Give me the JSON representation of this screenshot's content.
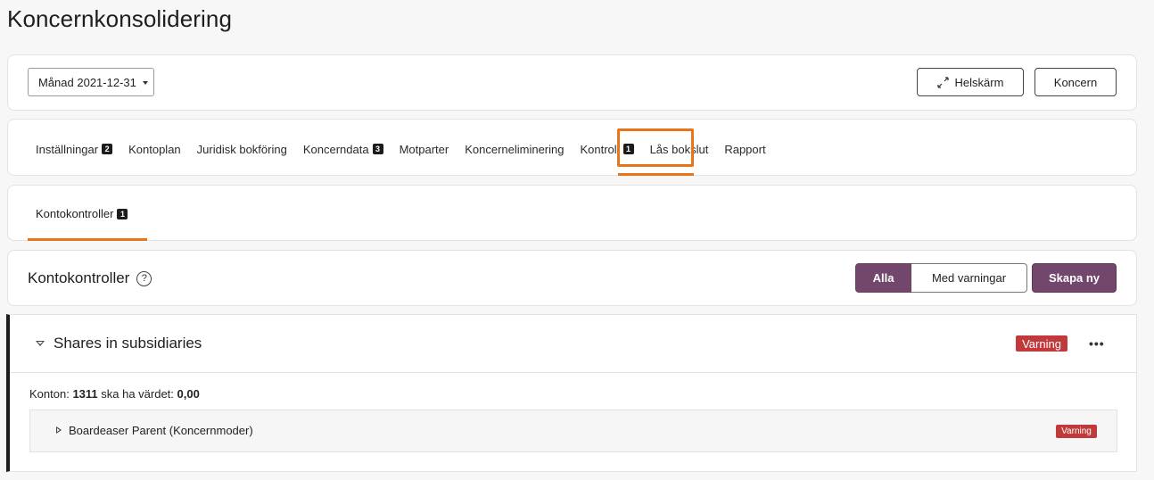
{
  "page": {
    "title": "Koncernkonsolidering"
  },
  "toolbar": {
    "period_value": "Månad 2021-12-31",
    "fullscreen_label": "Helskärm",
    "koncern_label": "Koncern"
  },
  "tabs": [
    {
      "label": "Inställningar",
      "badge": "2"
    },
    {
      "label": "Kontoplan",
      "badge": ""
    },
    {
      "label": "Juridisk bokföring",
      "badge": ""
    },
    {
      "label": "Koncerndata",
      "badge": "3"
    },
    {
      "label": "Motparter",
      "badge": ""
    },
    {
      "label": "Koncerneliminering",
      "badge": ""
    },
    {
      "label": "Kontroll",
      "badge": "1"
    },
    {
      "label": "Lås bokslut",
      "badge": ""
    },
    {
      "label": "Rapport",
      "badge": ""
    }
  ],
  "subtabs": {
    "label": "Kontokontroller",
    "badge": "1"
  },
  "section": {
    "title": "Kontokontroller",
    "help_glyph": "?",
    "filter_all": "Alla",
    "filter_warnings": "Med varningar",
    "create_label": "Skapa ny"
  },
  "control": {
    "title": "Shares in subsidiaries",
    "status": "Varning",
    "more_glyph": "•••",
    "rule_prefix": "Konton: ",
    "rule_account": "1311",
    "rule_middle": " ska ha värdet: ",
    "rule_value": "0,00",
    "entities": [
      {
        "name": "Boardeaser Parent (Koncernmoder)",
        "status": "Varning"
      }
    ]
  },
  "colors": {
    "accent_orange": "#e8751a",
    "brand_purple": "#73476c",
    "warning_red": "#c0393b"
  }
}
